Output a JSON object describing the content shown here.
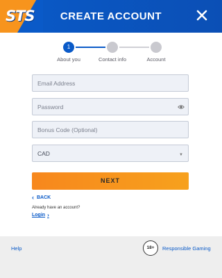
{
  "header": {
    "logo_text": "STS",
    "title": "CREATE ACCOUNT",
    "close_icon": "close-icon",
    "colors": {
      "header_blue": "#0a5ac8",
      "logo_orange": "#f7941d"
    }
  },
  "stepper": {
    "steps": [
      {
        "number": "1",
        "label": "About you",
        "state": "active"
      },
      {
        "number": "",
        "label": "Contact info",
        "state": "inactive"
      },
      {
        "number": "",
        "label": "Account",
        "state": "inactive"
      }
    ],
    "colors": {
      "active": "#0a5ac8",
      "inactive": "#c9c9cf"
    }
  },
  "form": {
    "email_placeholder": "Email Address",
    "password_placeholder": "Password",
    "password_toggle_icon": "eye-icon",
    "bonus_placeholder": "Bonus Code (Optional)",
    "currency_selected": "CAD",
    "currency_caret_icon": "caret-down-icon",
    "next_label": "NEXT",
    "next_color": "#f7941d"
  },
  "links": {
    "back_label": "BACK",
    "already_text": "Already have an account?",
    "login_label": "Login"
  },
  "footer": {
    "help_label": "Help",
    "age_badge": "18+",
    "responsible_gaming_label": "Responsible Gaming"
  }
}
